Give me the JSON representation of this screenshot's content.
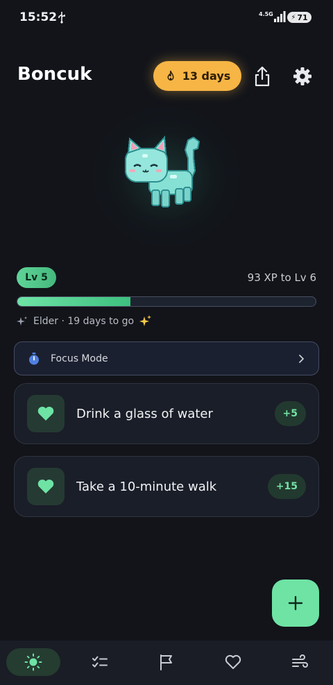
{
  "status_bar": {
    "time": "15:52",
    "network": "4.5G",
    "battery": "71"
  },
  "header": {
    "title": "Boncuk",
    "streak_label": "13 days"
  },
  "pet": {
    "icon": "pixel-cat-icon"
  },
  "level": {
    "badge": "Lv 5",
    "xp_to_next": "93 XP to Lv 6",
    "progress": 0.38,
    "stage_text": "Elder · 19 days to go"
  },
  "focus": {
    "label": "Focus Mode"
  },
  "habits": [
    {
      "label": "Drink a glass of water",
      "xp": "+5",
      "icon": "heart-icon"
    },
    {
      "label": "Take a 10-minute walk",
      "xp": "+15",
      "icon": "heart-icon"
    }
  ],
  "nav": {
    "items": [
      "home",
      "tasks",
      "goals",
      "favorites",
      "breathing"
    ],
    "active": "home"
  },
  "colors": {
    "accent": "#6ee3a4",
    "streak": "#f6b545",
    "background": "#12141a"
  }
}
